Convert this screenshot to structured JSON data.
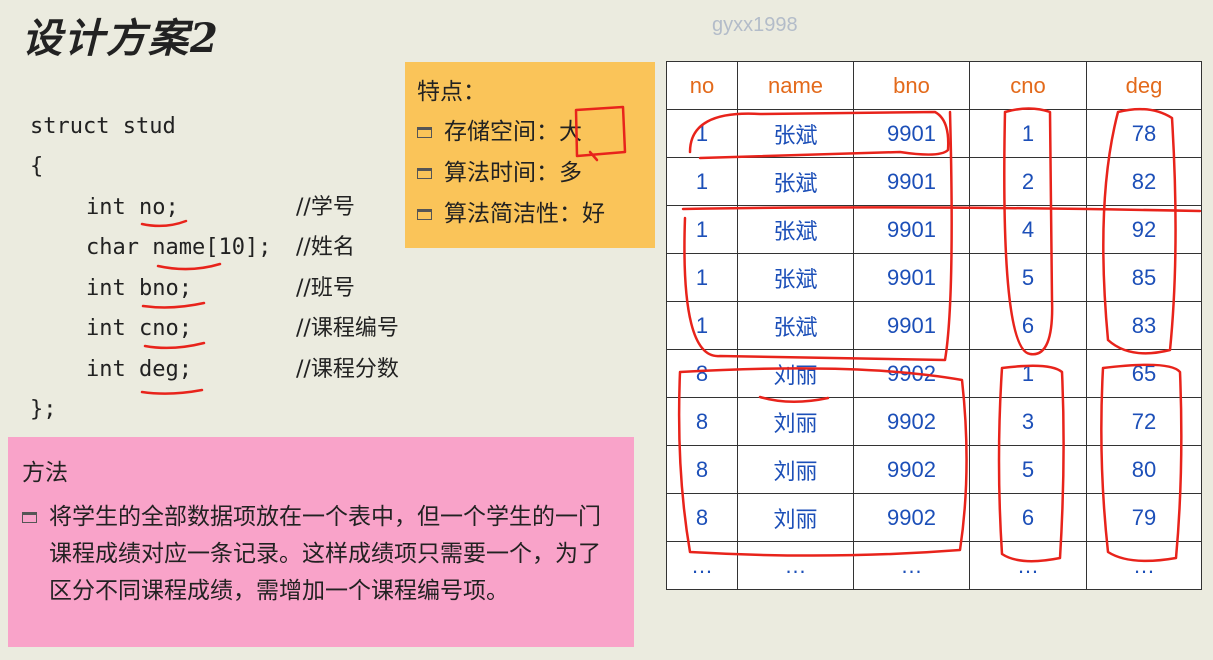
{
  "title": "设计方案2",
  "watermark": "gyxx1998",
  "code": {
    "lines": [
      "struct stud",
      "{",
      "int no;",
      "char name[10];",
      "int bno;",
      "int cno;",
      "int deg;",
      "};"
    ],
    "comments": [
      "//学号",
      "//姓名",
      "//班号",
      "//课程编号",
      "//课程分数"
    ]
  },
  "features": {
    "heading": "特点：",
    "items": [
      "存储空间：大",
      "算法时间：多",
      "算法简洁性：好"
    ]
  },
  "method": {
    "heading": "方法",
    "text": "将学生的全部数据项放在一个表中，但一个学生的一门课程成绩对应一条记录。这样成绩项只需要一个，为了区分不同课程成绩，需增加一个课程编号项。"
  },
  "table": {
    "headers": [
      "no",
      "name",
      "bno",
      "cno",
      "deg"
    ],
    "rows": [
      [
        "1",
        "张斌",
        "9901",
        "1",
        "78"
      ],
      [
        "1",
        "张斌",
        "9901",
        "2",
        "82"
      ],
      [
        "1",
        "张斌",
        "9901",
        "4",
        "92"
      ],
      [
        "1",
        "张斌",
        "9901",
        "5",
        "85"
      ],
      [
        "1",
        "张斌",
        "9901",
        "6",
        "83"
      ],
      [
        "8",
        "刘丽",
        "9902",
        "1",
        "65"
      ],
      [
        "8",
        "刘丽",
        "9902",
        "3",
        "72"
      ],
      [
        "8",
        "刘丽",
        "9902",
        "5",
        "80"
      ],
      [
        "8",
        "刘丽",
        "9902",
        "6",
        "79"
      ],
      [
        "…",
        "…",
        "…",
        "…",
        "…"
      ]
    ]
  },
  "colors": {
    "header_text": "#e36a1b",
    "cell_text": "#1c4fb8",
    "annotation": "#e8231b",
    "feature_box": "#fac459",
    "method_box": "#f9a3c9"
  }
}
